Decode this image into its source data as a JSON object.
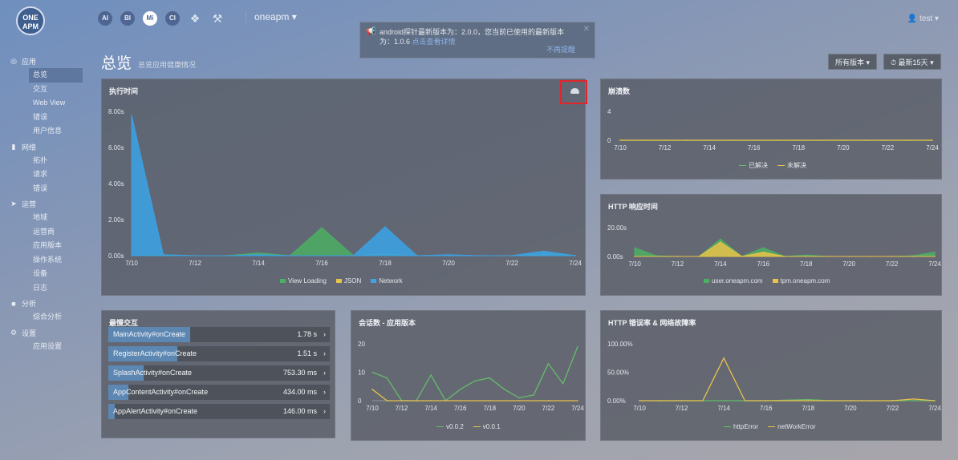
{
  "topbar": {
    "logo_text": "ONE APM",
    "products": [
      "AI",
      "BI",
      "Mi",
      "CI"
    ],
    "tools": [
      "handshake-icon",
      "tools-icon"
    ],
    "app_name": "oneapm",
    "user": "test"
  },
  "notice": {
    "line1": "android探针最新版本为：2.0.0，您当前已使用的最新版本",
    "line2": "为：1.0.6",
    "link": "点击查看详情",
    "dismiss": "不再提醒"
  },
  "sidebar": [
    {
      "label": "应用",
      "icon": "globe-icon",
      "items": [
        "总览",
        "交互",
        "Web View",
        "错误",
        "用户信息"
      ]
    },
    {
      "label": "网络",
      "icon": "signal-icon",
      "items": [
        "拓扑",
        "请求",
        "错误"
      ]
    },
    {
      "label": "运营",
      "icon": "rocket-icon",
      "items": [
        "地域",
        "运营商",
        "应用版本",
        "操作系统",
        "设备",
        "日志"
      ]
    },
    {
      "label": "分析",
      "icon": "chart-icon",
      "items": [
        "综合分析"
      ]
    },
    {
      "label": "设置",
      "icon": "gear-icon",
      "items": [
        "应用设置"
      ]
    }
  ],
  "page": {
    "title": "总览",
    "subtitle": "总览应用健康情况",
    "version_filter": "所有版本",
    "time_filter": "最新15天"
  },
  "panels": {
    "exec_time": {
      "title": "执行时间"
    },
    "crash": {
      "title": "崩溃数"
    },
    "http_resp": {
      "title": "HTTP 响应时间"
    },
    "slowest": {
      "title": "最慢交互",
      "rows": [
        {
          "name": "MainActivity#onCreate",
          "value": "1.78 s",
          "ratio": 0.37
        },
        {
          "name": "RegisterActivity#onCreate",
          "value": "1.51 s",
          "ratio": 0.31
        },
        {
          "name": "SplashActivity#onCreate",
          "value": "753.30 ms",
          "ratio": 0.16
        },
        {
          "name": "AppContentActivity#onCreate",
          "value": "434.00 ms",
          "ratio": 0.09
        },
        {
          "name": "AppAlertActivity#onCreate",
          "value": "146.00 ms",
          "ratio": 0.03
        }
      ]
    },
    "sessions": {
      "title": "会话数 - 应用版本"
    },
    "http_err": {
      "title": "HTTP 错误率 & 网络故障率"
    }
  },
  "chart_data": [
    {
      "type": "area",
      "title": "执行时间",
      "x": [
        "7/10",
        "7/11",
        "7/12",
        "7/13",
        "7/14",
        "7/15",
        "7/16",
        "7/17",
        "7/18",
        "7/19",
        "7/20",
        "7/21",
        "7/22",
        "7/23",
        "7/24"
      ],
      "xticks": [
        "7/10",
        "7/12",
        "7/14",
        "7/16",
        "7/18",
        "7/20",
        "7/22",
        "7/24"
      ],
      "yticks": [
        "0.00s",
        "2.00s",
        "4.00s",
        "6.00s",
        "8.00s"
      ],
      "ylim": [
        0,
        8
      ],
      "series": [
        {
          "name": "View Loading",
          "color": "#4caf63",
          "values": [
            0,
            0.05,
            0,
            0,
            0.15,
            0,
            1.55,
            0,
            0.1,
            0,
            0,
            0,
            0,
            0.1,
            0
          ]
        },
        {
          "name": "JSON",
          "color": "#e8c24a",
          "values": [
            0,
            0,
            0,
            0,
            0,
            0,
            0,
            0,
            0,
            0,
            0,
            0,
            0,
            0,
            0
          ]
        },
        {
          "name": "Network",
          "color": "#3ba3e6",
          "values": [
            7.8,
            0.05,
            0,
            0,
            0.05,
            0,
            0,
            0,
            1.6,
            0,
            0.05,
            0,
            0,
            0.25,
            0
          ]
        }
      ]
    },
    {
      "type": "line",
      "title": "崩溃数",
      "x": [
        "7/10",
        "7/11",
        "7/12",
        "7/13",
        "7/14",
        "7/15",
        "7/16",
        "7/17",
        "7/18",
        "7/19",
        "7/20",
        "7/21",
        "7/22",
        "7/23",
        "7/24"
      ],
      "xticks": [
        "7/10",
        "7/12",
        "7/14",
        "7/16",
        "7/18",
        "7/20",
        "7/22",
        "7/24"
      ],
      "yticks": [
        "0",
        "4"
      ],
      "ylim": [
        0,
        4
      ],
      "series": [
        {
          "name": "已解决",
          "color": "#66bb6a",
          "values": [
            0,
            0,
            0,
            0,
            0,
            0,
            0,
            0,
            0,
            0,
            0,
            0,
            0,
            0,
            0
          ]
        },
        {
          "name": "未解决",
          "color": "#e8c24a",
          "values": [
            0,
            0,
            0,
            0,
            0,
            0,
            0,
            0,
            0,
            0,
            0,
            0,
            0,
            0,
            0
          ]
        }
      ]
    },
    {
      "type": "area",
      "title": "HTTP 响应时间",
      "x": [
        "7/10",
        "7/11",
        "7/12",
        "7/13",
        "7/14",
        "7/15",
        "7/16",
        "7/17",
        "7/18",
        "7/19",
        "7/20",
        "7/21",
        "7/22",
        "7/23",
        "7/24"
      ],
      "xticks": [
        "7/10",
        "7/12",
        "7/14",
        "7/16",
        "7/18",
        "7/20",
        "7/22",
        "7/24"
      ],
      "yticks": [
        "0.00s",
        "20.00s"
      ],
      "ylim": [
        0,
        20
      ],
      "series": [
        {
          "name": "user.oneapm.com",
          "color": "#4caf63",
          "values": [
            6,
            0.5,
            0,
            0,
            12,
            0,
            6,
            0,
            1,
            0,
            0,
            0,
            0,
            0.5,
            3
          ]
        },
        {
          "name": "tpm.oneapm.com",
          "color": "#e8c24a",
          "values": [
            0,
            0,
            0,
            0,
            10,
            0,
            3,
            0,
            0,
            0,
            0,
            0,
            0,
            0,
            0
          ]
        }
      ]
    },
    {
      "type": "line",
      "title": "会话数 - 应用版本",
      "x": [
        "7/10",
        "7/11",
        "7/12",
        "7/13",
        "7/14",
        "7/15",
        "7/16",
        "7/17",
        "7/18",
        "7/19",
        "7/20",
        "7/21",
        "7/22",
        "7/23",
        "7/24"
      ],
      "xticks": [
        "7/10",
        "7/12",
        "7/14",
        "7/16",
        "7/18",
        "7/20",
        "7/22",
        "7/24"
      ],
      "yticks": [
        "0",
        "10",
        "20"
      ],
      "ylim": [
        0,
        20
      ],
      "series": [
        {
          "name": "v0.0.2",
          "color": "#66bb6a",
          "values": [
            10,
            8,
            0,
            0,
            9,
            0,
            4,
            7,
            8,
            4,
            1,
            2,
            13,
            6,
            19,
            0
          ]
        },
        {
          "name": "v0.0.1",
          "color": "#e8c24a",
          "values": [
            4,
            0,
            0,
            0,
            0,
            0,
            0,
            0,
            0,
            0,
            0,
            0,
            0,
            0,
            0,
            0
          ]
        }
      ]
    },
    {
      "type": "line",
      "title": "HTTP 错误率 & 网络故障率",
      "x": [
        "7/10",
        "7/11",
        "7/12",
        "7/13",
        "7/14",
        "7/15",
        "7/16",
        "7/17",
        "7/18",
        "7/19",
        "7/20",
        "7/21",
        "7/22",
        "7/23",
        "7/24"
      ],
      "xticks": [
        "7/10",
        "7/12",
        "7/14",
        "7/16",
        "7/18",
        "7/20",
        "7/22",
        "7/24"
      ],
      "yticks": [
        "0.00%",
        "50.00%",
        "100.00%"
      ],
      "ylim": [
        0,
        100
      ],
      "series": [
        {
          "name": "httpError",
          "color": "#66bb6a",
          "values": [
            0,
            0,
            0,
            0,
            0,
            0,
            0,
            1,
            2,
            0,
            0,
            0,
            0,
            0,
            0
          ]
        },
        {
          "name": "netWorkError",
          "color": "#e8c24a",
          "values": [
            0,
            0,
            0,
            0,
            75,
            0,
            0,
            0,
            0,
            0,
            0,
            0,
            0,
            3,
            0
          ]
        }
      ]
    }
  ]
}
